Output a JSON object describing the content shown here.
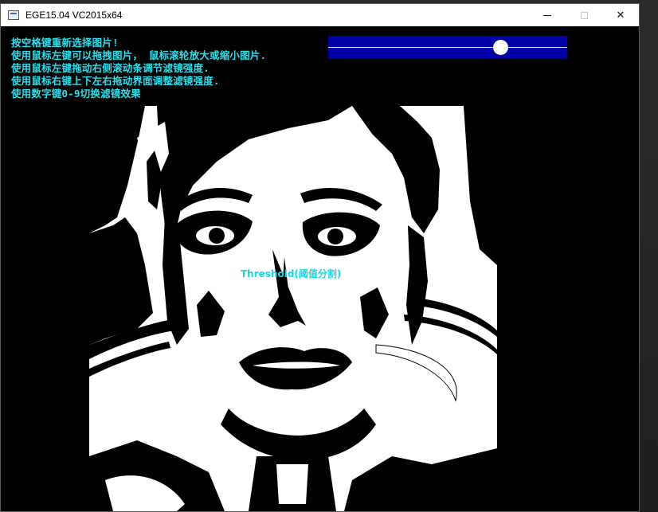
{
  "window": {
    "title": "EGE15.04 VC2015x64",
    "controls": {
      "minimize": "",
      "maximize": "",
      "close": "✕"
    }
  },
  "instructions": [
    "按空格键重新选择图片!",
    "使用鼠标左键可以拖拽图片， 鼠标滚轮放大或缩小图片.",
    "使用鼠标左键拖动右侧滚动条调节滤镜强度.",
    "使用鼠标右键上下左右拖动界面调整滤镜强度.",
    "使用数字键0-9切换滤镜效果"
  ],
  "slider": {
    "value": 0.72,
    "track_color": "#0000a8",
    "thumb_color": "#ffffff"
  },
  "filter": {
    "label": "Threshold(阈值分割)",
    "label_color": "#18d6ea"
  },
  "colors": {
    "instruction_text": "#27e0ee",
    "client_background": "#000000"
  }
}
